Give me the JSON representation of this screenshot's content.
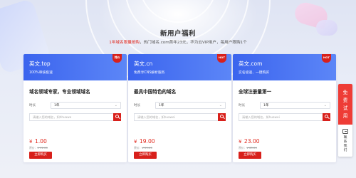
{
  "header": {
    "title": "新用户福利",
    "subtitle_highlight": "1年域名限量抢购",
    "subtitle_rest": "，热门域名.com首年23元，华为云VIP用户，每用户限购1个"
  },
  "cards": [
    {
      "name": "英文.top",
      "desc": "100%审核极速",
      "badge": "特价",
      "slogan": "域名领域专家，专业领域域名",
      "period_label": "时长",
      "period_value": "1年",
      "search_placeholder": "请输入您的域名，如hhuawe",
      "price_symbol": "¥",
      "price": "1.00",
      "original_label": "原价：",
      "original_price": "¥ 11.00",
      "buy_label": "立即购买"
    },
    {
      "name": "英文.cn",
      "desc": "免费享CNS解析服务",
      "badge": "HOT",
      "slogan": "最具中国特色的域名",
      "period_label": "时长",
      "period_value": "1年",
      "search_placeholder": "请输入您的域名，如huawei",
      "price_symbol": "¥",
      "price": "19.00",
      "original_label": "原价：",
      "original_price": "¥ 29.00",
      "buy_label": "立即购买"
    },
    {
      "name": "英文.com",
      "desc": "实名极速、一键购买",
      "badge": "HOT",
      "slogan": "全球注册量第一",
      "period_label": "时长",
      "period_value": "1年",
      "search_placeholder": "请输入您的域名，如huawei",
      "price_symbol": "¥",
      "price": "23.00",
      "original_label": "原价：",
      "original_price": "¥ 65.00",
      "buy_label": "立即购买"
    }
  ],
  "sidebar": {
    "trial_chars": [
      "免",
      "费",
      "试",
      "用"
    ],
    "feedback_chars": [
      "联",
      "系",
      "我",
      "们"
    ]
  },
  "colors": {
    "accent_red": "#d8201b",
    "card_header_blue": "#3b64ee",
    "highlight_red": "#e0261b"
  }
}
